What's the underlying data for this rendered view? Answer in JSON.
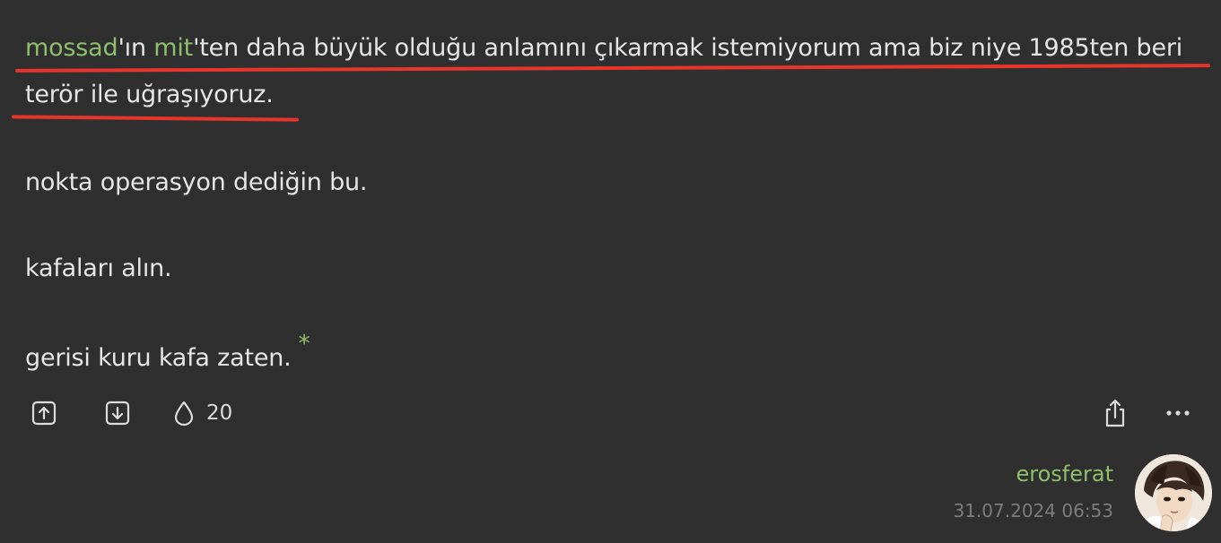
{
  "entry": {
    "paragraph1": {
      "link1": "mossad",
      "text1": "'ın ",
      "link2": "mit",
      "text2": "'ten daha büyük olduğu anlamını çıkarmak istemiyorum ama biz niye 1985ten beri",
      "line2": "terör ile uğraşıyoruz."
    },
    "paragraph2": "nokta operasyon dediğin bu.",
    "paragraph3": "kafaları alın.",
    "paragraph4": "gerisi kuru kafa zaten.",
    "star": "*"
  },
  "actions": {
    "upvote_icon": "upvote-icon",
    "downvote_icon": "downvote-icon",
    "favorite_icon": "drop-icon",
    "favorite_count": "20",
    "share_icon": "share-icon",
    "more_icon": "more-icon"
  },
  "author": {
    "name": "erosferat",
    "date": "31.07.2024 06:53"
  },
  "colors": {
    "background": "#2f2f2f",
    "text": "#e6e6e6",
    "link": "#8fbf6a",
    "underline": "#e8352b",
    "date": "#7c7c7c"
  }
}
